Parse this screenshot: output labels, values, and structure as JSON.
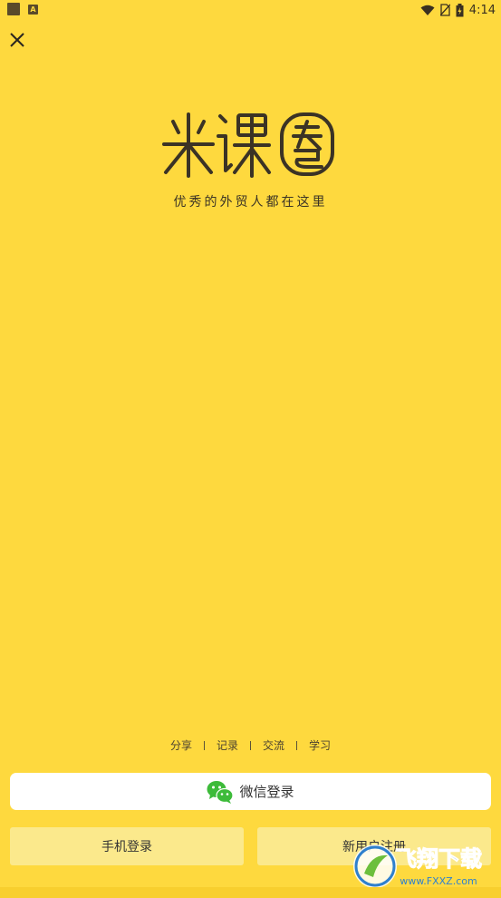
{
  "status_bar": {
    "time": "4:14"
  },
  "app": {
    "tagline": "优秀的外贸人都在这里"
  },
  "features": [
    "分享",
    "记录",
    "交流",
    "学习"
  ],
  "buttons": {
    "wechat_login": "微信登录",
    "phone_login": "手机登录",
    "new_user_register": "新用户注册"
  },
  "watermark": {
    "title": "飞翔下载",
    "url": "www.FXXZ.com"
  },
  "colors": {
    "background": "#FED93E",
    "wechat_green": "#3DBB3A",
    "secondary_button": "#FBE98C",
    "watermark_blue": "#2F80CE"
  }
}
